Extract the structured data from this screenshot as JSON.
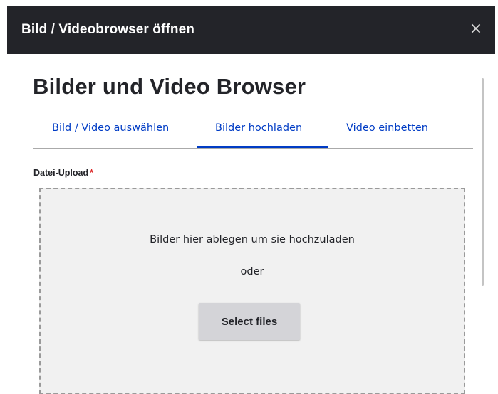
{
  "dialog": {
    "title": "Bild / Videobrowser öffnen",
    "close_icon": "×"
  },
  "page": {
    "heading": "Bilder und Video Browser"
  },
  "tabs": [
    {
      "label": "Bild / Video auswählen",
      "active": false
    },
    {
      "label": "Bilder hochladen",
      "active": true
    },
    {
      "label": "Video einbetten",
      "active": false
    }
  ],
  "upload": {
    "label": "Datei-Upload",
    "required_marker": "*",
    "drop_text": "Bilder hier ablegen um sie hochzuladen",
    "or_text": "oder",
    "button_label": "Select files"
  },
  "colors": {
    "titlebar_bg": "#232429",
    "link": "#003cc5",
    "required": "#dc2323",
    "dropzone_bg": "#f1f1f1"
  }
}
